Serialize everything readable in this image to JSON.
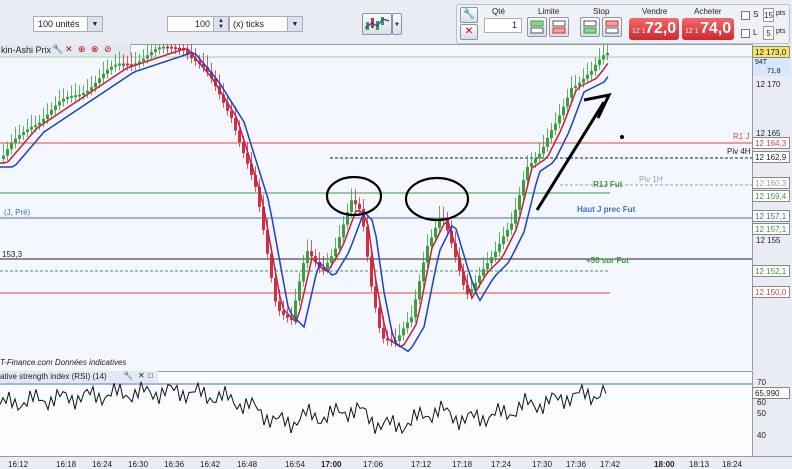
{
  "toolbar": {
    "quantity_select": "100 unités",
    "ticks_value": "100",
    "ticks_unit": "(x) ticks"
  },
  "ticket": {
    "qty_label": "Qté",
    "qty_value": "1",
    "limit_label": "Limite",
    "stop_label": "Stop",
    "sell_label": "Vendre",
    "buy_label": "Acheter",
    "sell_small": "12 1",
    "sell_big": "72,0",
    "buy_small": "12 1",
    "buy_big": "74,0",
    "s_label": "S",
    "l_label": "L",
    "pts_top_value": "15",
    "pts_top_unit": "pts",
    "pts_bottom_value": "5",
    "pts_bottom_unit": "pts"
  },
  "chart": {
    "title": "kin-Ashi Prix",
    "source_note": "T-Finance.com  Données indicatives",
    "left_label_top": "(J, Pré)",
    "left_label_mid": "153,3",
    "price_tag": "94T",
    "price_tag_value": "71,8"
  },
  "levels": [
    {
      "name": "R1 J",
      "value": "12 164,3",
      "color": "#e2453c"
    },
    {
      "name": "Piv 4H",
      "value": "12 162,9",
      "color": "#222222"
    },
    {
      "name": "Piv 1H",
      "value": "12 160,3",
      "color": "#9aa3ad"
    },
    {
      "name": "R1J Fut",
      "value": "12 159,4",
      "color": "#3d9a3d"
    },
    {
      "name": "Haut J prec Fut",
      "value": "12 157,1",
      "color": "#3b6fd1"
    },
    {
      "name": "",
      "value": "12 157,1",
      "color": "#3d9a3d"
    },
    {
      "name": "+50 sur Fut",
      "value": "12 152,1",
      "color": "#3d9a3d"
    },
    {
      "name": "",
      "value": "12 150,0",
      "color": "#e2453c"
    }
  ],
  "price_axis": {
    "current": "12 173,0",
    "ticks": [
      "12 170",
      "12 165",
      "12 155"
    ]
  },
  "rsi": {
    "title": "ative strength index (RSI) (14)",
    "value": "65,990",
    "ticks": [
      "70",
      "60",
      "50",
      "40"
    ]
  },
  "time_axis": [
    "16:12",
    "16:18",
    "16:24",
    "16:30",
    "16:36",
    "16:42",
    "16:48",
    "16:54",
    "17:00",
    "17:06",
    "17:12",
    "17:18",
    "17:24",
    "17:30",
    "17:36",
    "17:42",
    "18:00",
    "18:13",
    "18:24"
  ],
  "colors": {
    "up": "#3aa03a",
    "down": "#cf3040",
    "ma_blue": "#1d3fd0",
    "ma_red": "#c81e3c",
    "chart_bg": "#f4f7fd",
    "sell": "#e0303a",
    "buy": "#dd2b36"
  },
  "icons": [
    "wrench-icon",
    "close-icon",
    "chart-type-icon",
    "chevron-down-icon"
  ]
}
